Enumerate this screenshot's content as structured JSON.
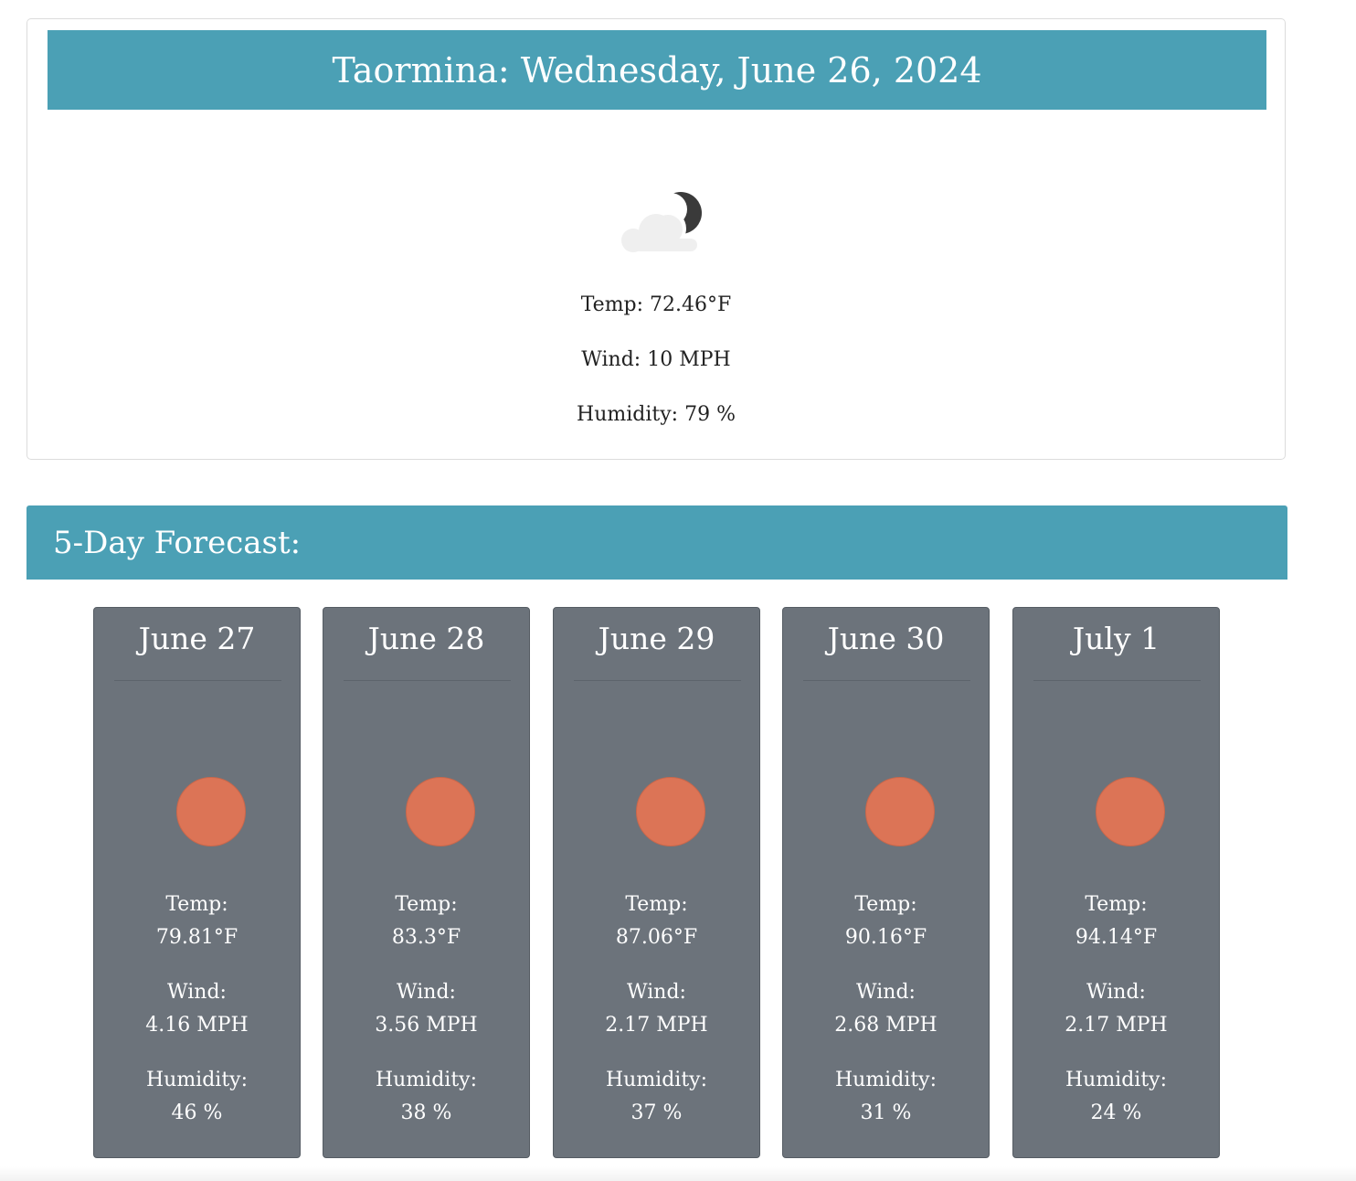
{
  "current": {
    "title": "Taormina: Wednesday, June 26, 2024",
    "icon": "partly-cloudy-night-icon",
    "temp": "Temp: 72.46°F",
    "wind": "Wind: 10 MPH",
    "humidity": "Humidity: 79 %"
  },
  "forecast": {
    "title": "5-Day Forecast:",
    "days": [
      {
        "date": "June 27",
        "icon": "sun-icon",
        "temp_label": "Temp:",
        "temp": "79.81°F",
        "wind_label": "Wind:",
        "wind": "4.16 MPH",
        "humidity_label": "Humidity:",
        "humidity": "46 %"
      },
      {
        "date": "June 28",
        "icon": "sun-icon",
        "temp_label": "Temp:",
        "temp": "83.3°F",
        "wind_label": "Wind:",
        "wind": "3.56 MPH",
        "humidity_label": "Humidity:",
        "humidity": "38 %"
      },
      {
        "date": "June 29",
        "icon": "sun-icon",
        "temp_label": "Temp:",
        "temp": "87.06°F",
        "wind_label": "Wind:",
        "wind": "2.17 MPH",
        "humidity_label": "Humidity:",
        "humidity": "37 %"
      },
      {
        "date": "June 30",
        "icon": "sun-icon",
        "temp_label": "Temp:",
        "temp": "90.16°F",
        "wind_label": "Wind:",
        "wind": "2.68 MPH",
        "humidity_label": "Humidity:",
        "humidity": "31 %"
      },
      {
        "date": "July 1",
        "icon": "sun-icon",
        "temp_label": "Temp:",
        "temp": "94.14°F",
        "wind_label": "Wind:",
        "wind": "2.17 MPH",
        "humidity_label": "Humidity:",
        "humidity": "24 %"
      }
    ]
  },
  "colors": {
    "header_bg": "#4ba0b5",
    "card_bg": "#6c737b",
    "sun": "#dc7456",
    "moon": "#3a3a3a",
    "cloud": "#efefef"
  }
}
